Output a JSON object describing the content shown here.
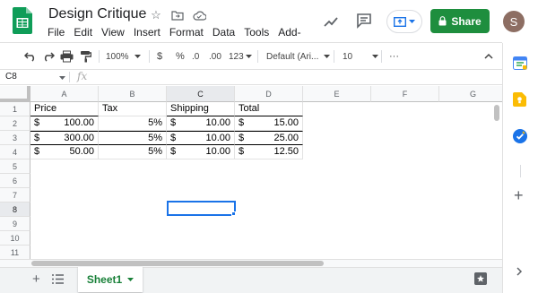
{
  "header": {
    "title": "Design Critique",
    "menu": [
      "File",
      "Edit",
      "View",
      "Insert",
      "Format",
      "Data",
      "Tools",
      "Add-ons"
    ],
    "share_label": "Share",
    "avatar_letter": "S",
    "share_color": "#1e8e3e",
    "brand_color": "#0f9d58"
  },
  "toolbar": {
    "zoom": "100%",
    "currency": "$",
    "percent": "%",
    "decrease_decimal": ".0",
    "increase_decimal": ".00",
    "number_format": "123",
    "font": "Default (Ari...",
    "font_size": "10",
    "more": "···"
  },
  "formula_bar": {
    "cell_ref": "C8",
    "fx": "fx"
  },
  "grid": {
    "columns": [
      "A",
      "B",
      "C",
      "D",
      "E",
      "F",
      "G"
    ],
    "rows": [
      "1",
      "2",
      "3",
      "4",
      "5",
      "6",
      "7",
      "8",
      "9",
      "10",
      "11"
    ],
    "selected_column": "C",
    "selected_row": "8",
    "cells": {
      "A1": "Price",
      "B1": "Tax",
      "C1": "Shipping",
      "D1": "Total",
      "A2_cur": "$",
      "A2": "100.00",
      "B2": "5%",
      "C2_cur": "$",
      "C2": "10.00",
      "D2_cur": "$",
      "D2": "15.00",
      "A3_cur": "$",
      "A3": "300.00",
      "B3": "5%",
      "C3_cur": "$",
      "C3": "10.00",
      "D3_cur": "$",
      "D3": "25.00",
      "A4_cur": "$",
      "A4": "50.00",
      "B4": "5%",
      "C4_cur": "$",
      "C4": "10.00",
      "D4_cur": "$",
      "D4": "12.50"
    }
  },
  "sheets": {
    "tabs": [
      "Sheet1"
    ],
    "active_tab": "Sheet1"
  }
}
